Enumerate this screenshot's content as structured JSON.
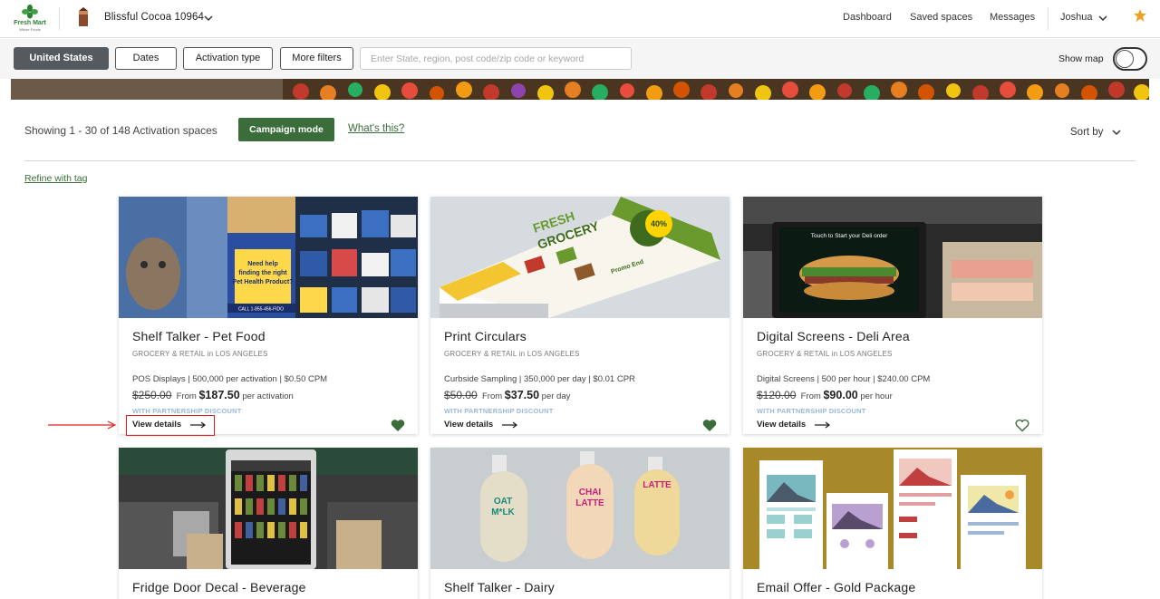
{
  "header": {
    "logo_brand": "Fresh Mart",
    "logo_sub": "Whole Foods",
    "store_name": "Blissful Cocoa 10964",
    "nav": [
      "Dashboard",
      "Saved spaces",
      "Messages"
    ],
    "user": "Joshua"
  },
  "filters": {
    "country": "United States",
    "dates": "Dates",
    "activation_type": "Activation type",
    "more_filters": "More filters",
    "search_placeholder": "Enter State, region, post code/zip code or keyword",
    "show_map": "Show map"
  },
  "results": {
    "showing": "Showing 1 - 30 of 148 Activation spaces",
    "campaign_mode": "Campaign mode",
    "whats_this": "What's this?",
    "sort_by": "Sort by",
    "refine": "Refine with tag"
  },
  "cards": [
    {
      "title": "Shelf Talker - Pet Food",
      "category": "GROCERY & RETAIL in LOS ANGELES",
      "specs": "POS Displays | 500,000 per activation | $0.50 CPM",
      "old_price": "$250.00",
      "from": "From",
      "new_price": "$187.50",
      "unit": "per activation",
      "discount": "WITH PARTNERSHIP DISCOUNT",
      "view": "View details",
      "favorited": true
    },
    {
      "title": "Print Circulars",
      "category": "GROCERY & RETAIL in LOS ANGELES",
      "specs": "Curbside Sampling | 350,000 per day | $0.01 CPR",
      "old_price": "$50.00",
      "from": "From",
      "new_price": "$37.50",
      "unit": "per day",
      "discount": "WITH PARTNERSHIP DISCOUNT",
      "view": "View details",
      "favorited": true
    },
    {
      "title": "Digital Screens - Deli Area",
      "category": "GROCERY & RETAIL in LOS ANGELES",
      "specs": "Digital Screens | 500 per hour | $240.00 CPM",
      "old_price": "$120.00",
      "from": "From",
      "new_price": "$90.00",
      "unit": "per hour",
      "discount": "WITH PARTNERSHIP DISCOUNT",
      "view": "View details",
      "favorited": false
    },
    {
      "title": "Fridge Door Decal - Beverage"
    },
    {
      "title": "Shelf Talker - Dairy"
    },
    {
      "title": "Email Offer - Gold Package"
    }
  ],
  "image_text": {
    "pet_sign": "Need help finding the right Pet Health Product?",
    "pet_phone": "CALL 1-855-456-FIDO",
    "circular_title": "FRESH GROCERY",
    "circular_promo": "Promo End",
    "circular_discount": "40%",
    "deli_screen": "Touch to Start your Deli order",
    "oat": "OAT M*LK",
    "chai": "CHAI LATTE",
    "latte": "LATTE"
  },
  "colors": {
    "accent_green": "#3b6d3a",
    "active_filter": "#555a5f",
    "discount_blue": "#9bb8d8",
    "annotation_red": "#e02020",
    "star": "#f0a020"
  }
}
